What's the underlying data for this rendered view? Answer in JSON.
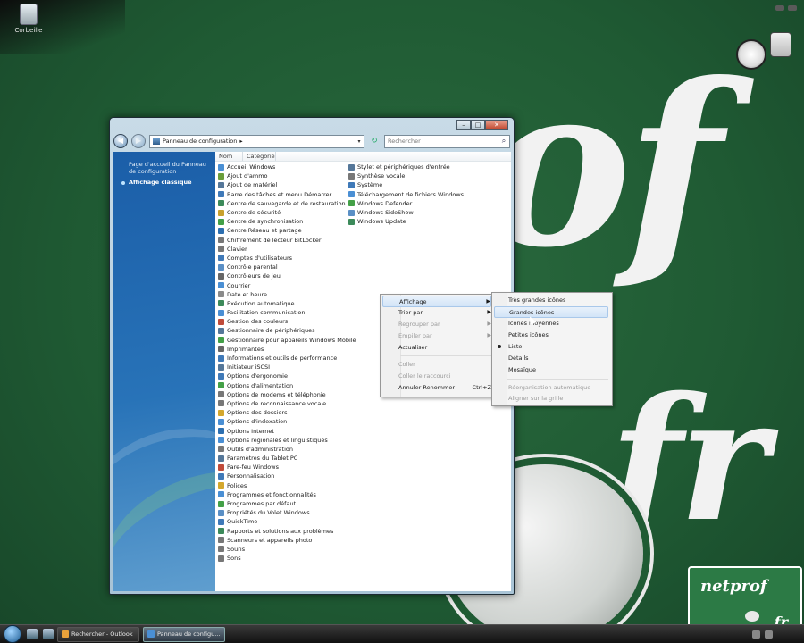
{
  "desktop": {
    "recycle_label": "Corbeille",
    "brand_of": "of",
    "brand_fr": ".fr"
  },
  "window": {
    "address": "Panneau de configuration",
    "search_placeholder": "Rechercher",
    "controls": {
      "minimize": "–",
      "maximize": "□",
      "close": "✕"
    }
  },
  "nav": {
    "home_link": "Page d'accueil du Panneau de configuration",
    "classic_view": "Affichage classique"
  },
  "columns": {
    "name": "Nom",
    "category": "Catégorie"
  },
  "items_left": [
    {
      "label": "Accueil Windows",
      "color": "#4a8fd4"
    },
    {
      "label": "Ajout d'ammo",
      "color": "#6a9e3a"
    },
    {
      "label": "Ajout de matériel",
      "color": "#557799"
    },
    {
      "label": "Barre des tâches et menu Démarrer",
      "color": "#3f79b8"
    },
    {
      "label": "Centre de sauvegarde et de restauration",
      "color": "#3c8a5a"
    },
    {
      "label": "Centre de sécurité",
      "color": "#c9a12c"
    },
    {
      "label": "Centre de synchronisation",
      "color": "#43a047"
    },
    {
      "label": "Centre Réseau et partage",
      "color": "#2d6fb0"
    },
    {
      "label": "Chiffrement de lecteur BitLocker",
      "color": "#777777"
    },
    {
      "label": "Clavier",
      "color": "#777777"
    },
    {
      "label": "Comptes d'utilisateurs",
      "color": "#3f79b8"
    },
    {
      "label": "Contrôle parental",
      "color": "#5a8fc5"
    },
    {
      "label": "Contrôleurs de jeu",
      "color": "#666666"
    },
    {
      "label": "Courrier",
      "color": "#4a8fd4"
    },
    {
      "label": "Date et heure",
      "color": "#8a8a8a"
    },
    {
      "label": "Exécution automatique",
      "color": "#3c8a5a"
    },
    {
      "label": "Facilitation communication",
      "color": "#4a8fd4"
    },
    {
      "label": "Gestion des couleurs",
      "color": "#c04b3a"
    },
    {
      "label": "Gestionnaire de périphériques",
      "color": "#557799"
    },
    {
      "label": "Gestionnaire pour appareils Windows Mobile",
      "color": "#43a047"
    },
    {
      "label": "Imprimantes",
      "color": "#666666"
    },
    {
      "label": "Informations et outils de performance",
      "color": "#3f79b8"
    },
    {
      "label": "Initiateur iSCSI",
      "color": "#557799"
    },
    {
      "label": "Options d'ergonomie",
      "color": "#3f79b8"
    },
    {
      "label": "Options d'alimentation",
      "color": "#43a047"
    },
    {
      "label": "Options de modems et téléphonie",
      "color": "#777777"
    },
    {
      "label": "Options de reconnaissance vocale",
      "color": "#777777"
    },
    {
      "label": "Options des dossiers",
      "color": "#d4a72c"
    },
    {
      "label": "Options d'indexation",
      "color": "#4a8fd4"
    },
    {
      "label": "Options Internet",
      "color": "#2d6fb0"
    },
    {
      "label": "Options régionales et linguistiques",
      "color": "#4a8fd4"
    },
    {
      "label": "Outils d'administration",
      "color": "#777777"
    },
    {
      "label": "Paramètres du Tablet PC",
      "color": "#557799"
    },
    {
      "label": "Pare-feu Windows",
      "color": "#c04b3a"
    },
    {
      "label": "Personnalisation",
      "color": "#3f79b8"
    },
    {
      "label": "Polices",
      "color": "#d4a72c"
    },
    {
      "label": "Programmes et fonctionnalités",
      "color": "#4a8fd4"
    },
    {
      "label": "Programmes par défaut",
      "color": "#43a047"
    },
    {
      "label": "Propriétés du Volet Windows",
      "color": "#5a8fc5"
    },
    {
      "label": "QuickTime",
      "color": "#3f79b8"
    },
    {
      "label": "Rapports et solutions aux problèmes",
      "color": "#3c8a5a"
    },
    {
      "label": "Scanneurs et appareils photo",
      "color": "#777777"
    },
    {
      "label": "Souris",
      "color": "#777777"
    },
    {
      "label": "Sons",
      "color": "#777777"
    }
  ],
  "items_right": [
    {
      "label": "Stylet et périphériques d'entrée",
      "color": "#557799"
    },
    {
      "label": "Synthèse vocale",
      "color": "#777777"
    },
    {
      "label": "Système",
      "color": "#3f79b8"
    },
    {
      "label": "Téléchargement de fichiers Windows",
      "color": "#4a8fd4"
    },
    {
      "label": "Windows Defender",
      "color": "#43a047"
    },
    {
      "label": "Windows SideShow",
      "color": "#5a8fc5"
    },
    {
      "label": "Windows Update",
      "color": "#3c8a5a"
    }
  ],
  "context_menu": {
    "affichage": "Affichage",
    "trier_par": "Trier par",
    "regrouper_par": "Regrouper par",
    "empiler_par": "Empiler par",
    "actualiser": "Actualiser",
    "coller": "Coller",
    "coller_raccourci": "Coller le raccourci",
    "annuler": "Annuler Renommer",
    "annuler_shortcut": "Ctrl+Z"
  },
  "submenu": {
    "tres_grandes": "Très grandes icônes",
    "grandes": "Grandes icônes",
    "icones_moyennes": "Icônes moyennes",
    "petites": "Petites icônes",
    "liste": "Liste",
    "details": "Détails",
    "mosaique": "Mosaïque",
    "reorg_auto": "Réorganisation automatique",
    "aligner": "Aligner sur la grille"
  },
  "logo": {
    "line1": "netprof",
    "line2": ".fr"
  },
  "taskbar": {
    "task1": "Rechercher - Outlook",
    "task2": "Panneau de configu..."
  }
}
